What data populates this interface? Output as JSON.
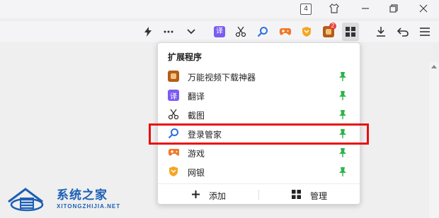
{
  "titlebar": {
    "tab_count": "4"
  },
  "popup": {
    "title": "扩展程序",
    "items": [
      {
        "label": "万能视频下载神器",
        "icon": "video-downloader-icon",
        "color": "#b35d1a"
      },
      {
        "label": "翻译",
        "icon": "translate-icon",
        "color": "#7b5cf0",
        "glyph": "译"
      },
      {
        "label": "截图",
        "icon": "scissors-icon",
        "color": "#333333"
      },
      {
        "label": "登录管家",
        "icon": "login-manager-icon",
        "color": "#2f6fe0"
      },
      {
        "label": "游戏",
        "icon": "gamepad-icon",
        "color": "#f07a2a"
      },
      {
        "label": "网银",
        "icon": "shield-icon",
        "color": "#f5a623"
      }
    ],
    "footer": {
      "add_label": "添加",
      "manage_label": "管理"
    }
  },
  "toolbar": {
    "translate_glyph": "译",
    "badge_count": "2"
  },
  "watermark": {
    "title": "系统之家",
    "subtitle": "XITONGZHIJIA.NET"
  },
  "colors": {
    "pin": "#2db34a",
    "highlight": "#e81010",
    "accent": "#2f6fe0"
  }
}
